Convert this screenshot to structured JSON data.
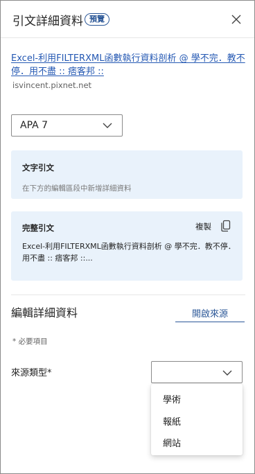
{
  "header": {
    "title": "引文詳細資料",
    "badge": "預覽",
    "close_icon": "close-icon"
  },
  "source": {
    "title_link": "Excel-利用FILTERXML函數執行資料剖析 @ 學不完．教不停．用不盡 :: 痞客邦 ::",
    "domain": "isvincent.pixnet.net"
  },
  "citation_style": {
    "selected": "APA 7",
    "icon": "chevron-down-icon"
  },
  "in_text_citation": {
    "heading": "文字引文",
    "hint": "在下方的編輯區段中新增詳細資料"
  },
  "full_citation": {
    "heading": "完整引文",
    "copy_label": "複製",
    "copy_icon": "copy-icon",
    "text": "Excel-利用FILTERXML函數執行資料剖析 @ 學不完．教不停．用不盡 :: 痞客邦 ::..."
  },
  "edit_details": {
    "title": "編輯詳細資料",
    "open_source_label": "開啟來源",
    "required_note": "* 必要項目",
    "source_type_label": "來源類型*",
    "source_type_value": "",
    "options": [
      "學術",
      "報紙",
      "網站"
    ]
  },
  "colors": {
    "accent": "#2b5797",
    "link": "#2458b3",
    "card_bg": "#e9f2fb"
  }
}
